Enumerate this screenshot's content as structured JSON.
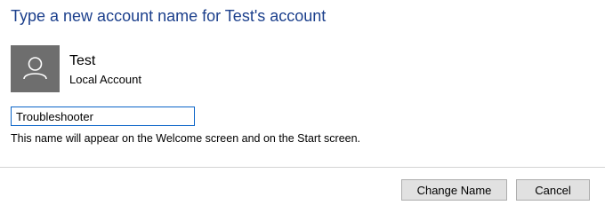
{
  "dialog": {
    "title": "Type a new account name for Test's account"
  },
  "account": {
    "avatar_icon": "user-icon",
    "name": "Test",
    "type": "Local Account"
  },
  "name_field": {
    "value": "Troubleshooter"
  },
  "hint_text": "This name will appear on the Welcome screen and on the Start screen.",
  "buttons": {
    "change_name": "Change Name",
    "cancel": "Cancel"
  },
  "colors": {
    "title": "#1b3f8c",
    "avatar_background": "#6e6e6e",
    "input_focus_border": "#0a64c8",
    "button_background": "#e1e1e1"
  }
}
